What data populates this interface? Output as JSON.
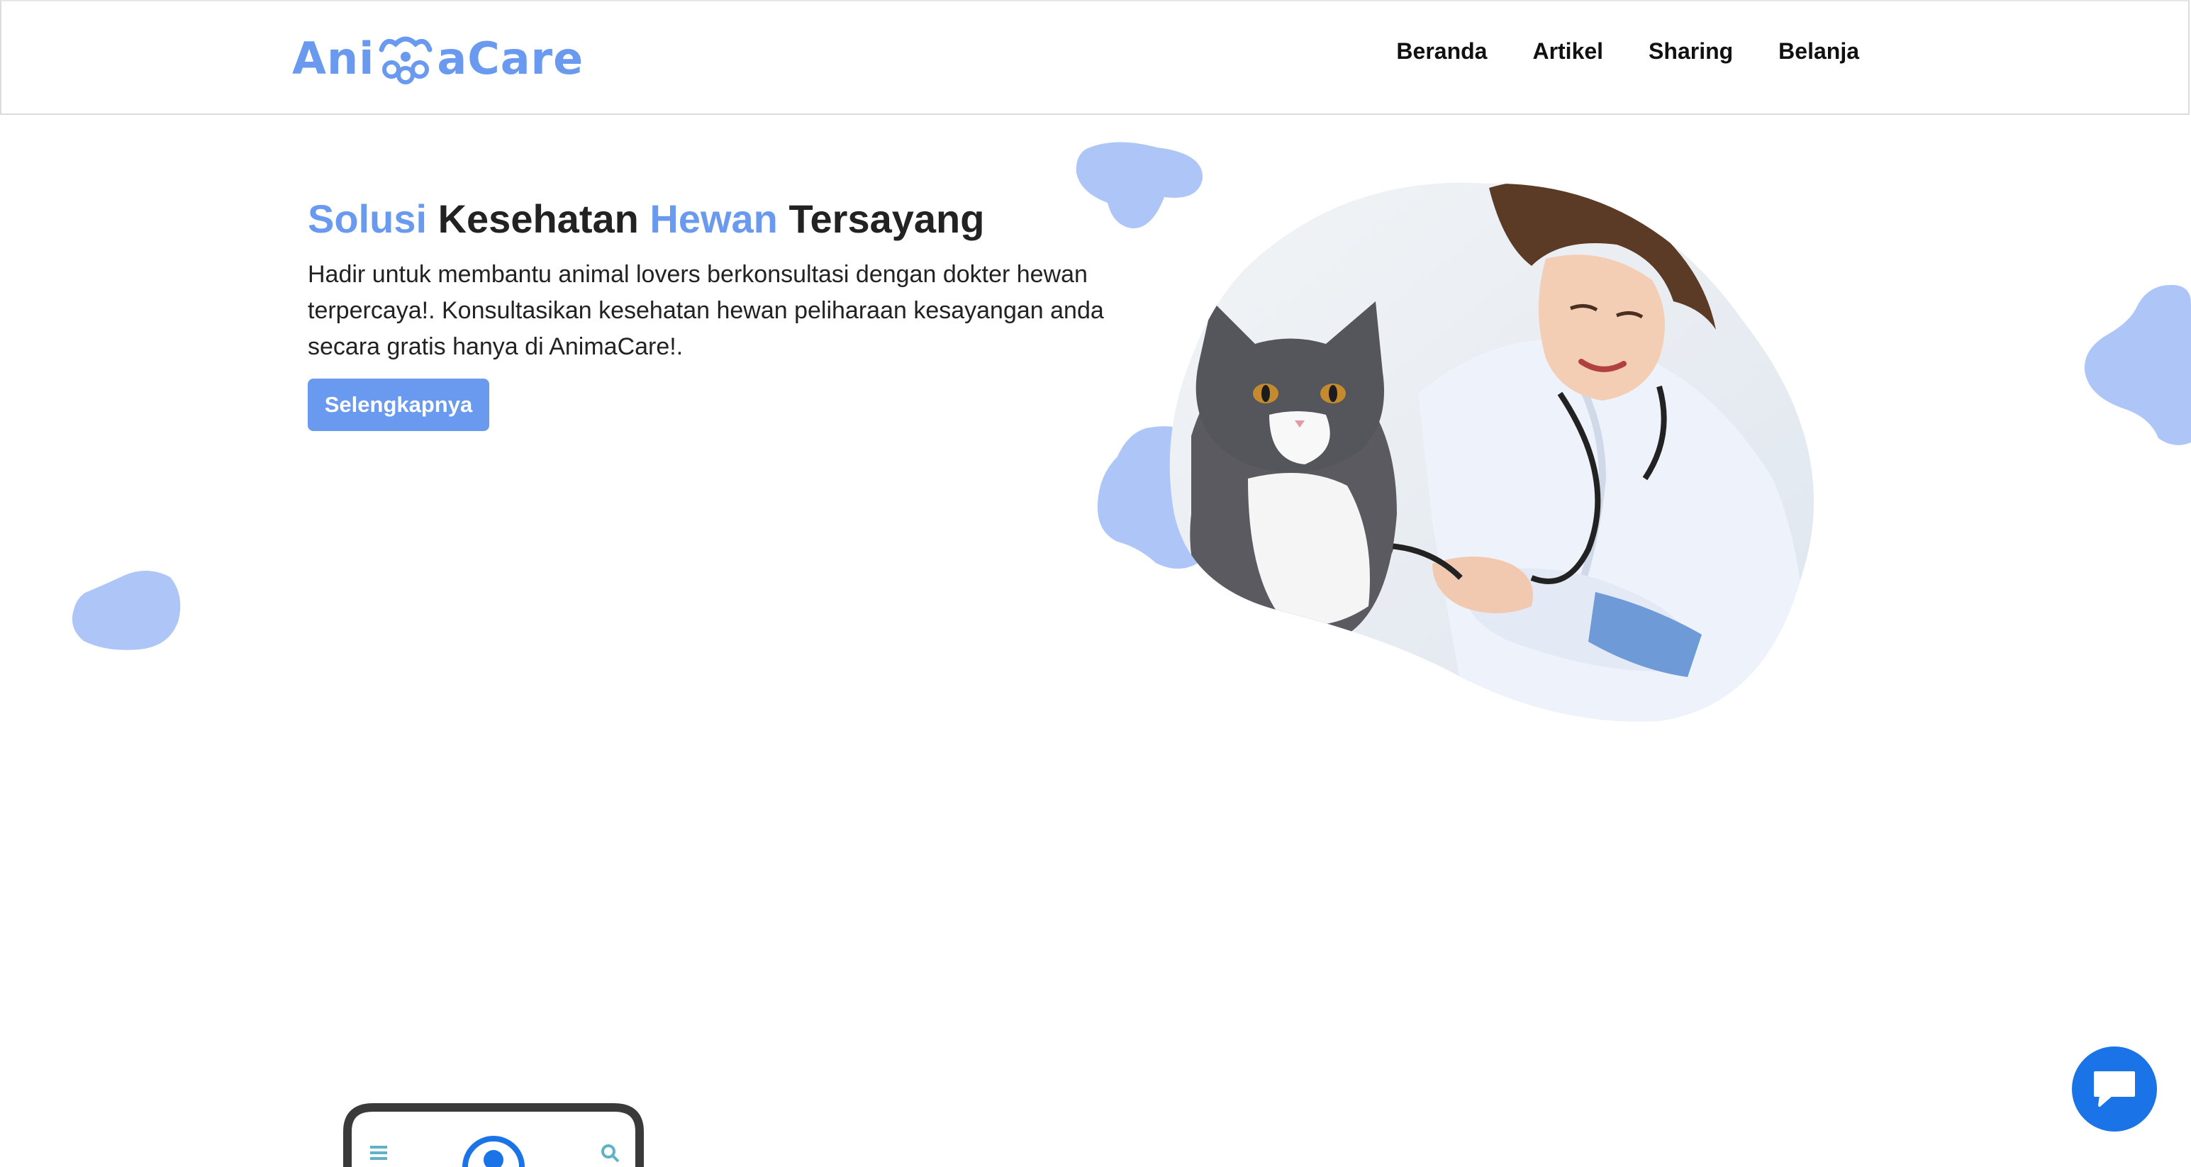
{
  "brand": {
    "name_part1": "Ani",
    "name_part2": "aCare",
    "logo_icon": "paw-icon",
    "accent_color": "#6a9af0"
  },
  "nav": {
    "items": [
      {
        "label": "Beranda"
      },
      {
        "label": "Artikel"
      },
      {
        "label": "Sharing"
      },
      {
        "label": "Belanja"
      }
    ]
  },
  "hero": {
    "title_word1": "Solusi",
    "title_word2": "Kesehatan",
    "title_word3": "Hewan",
    "title_word4": "Tersayang",
    "description": "Hadir untuk membantu animal lovers berkonsultasi dengan dokter hewan terpercaya!. Konsultasikan kesehatan hewan peliharaan kesayangan anda secara gratis hanya di AnimaCare!.",
    "button_label": "Selengkapnya",
    "image_icon": "vet-with-cat-illustration"
  },
  "chat": {
    "icon": "chat-bubble-icon",
    "color": "#1a74e8"
  },
  "colors": {
    "blob": "#aec6f7",
    "text": "#222222"
  }
}
